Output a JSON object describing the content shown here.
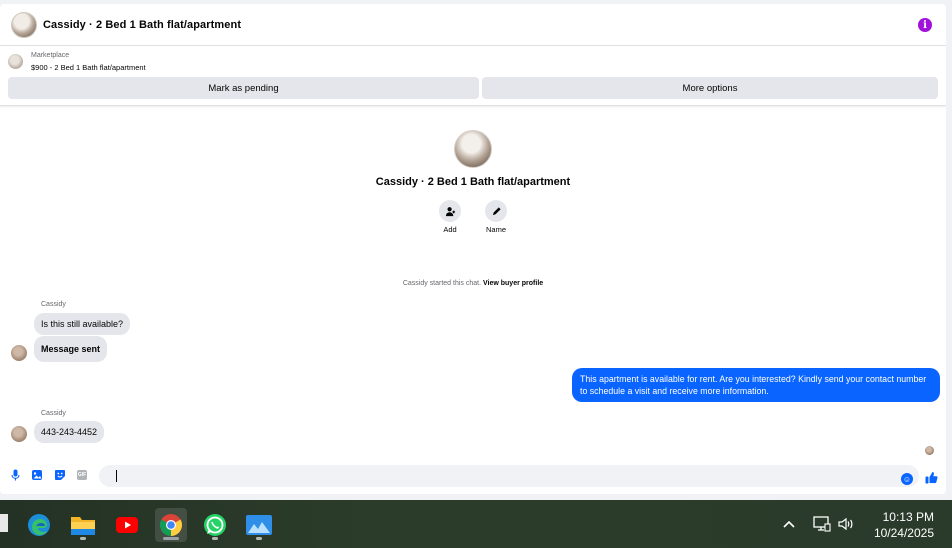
{
  "header": {
    "title": "Cassidy · 2 Bed 1 Bath flat/apartment",
    "info_icon": "i"
  },
  "listing": {
    "source": "Marketplace",
    "price_title": "$900 - 2 Bed 1 Bath flat/apartment",
    "mark_pending_label": "Mark as pending",
    "more_options_label": "More options"
  },
  "profile": {
    "name": "Cassidy · 2 Bed 1 Bath flat/apartment",
    "actions": [
      {
        "label": "Add",
        "icon": "add-person-icon"
      },
      {
        "label": "Name",
        "icon": "pencil-icon"
      }
    ]
  },
  "conversation": {
    "started_text": "Cassidy started this chat.",
    "view_profile_link": "View buyer profile",
    "messages": [
      {
        "sender": "Cassidy",
        "text": "Is this still available?"
      },
      {
        "sender": "",
        "text": "Message sent"
      },
      {
        "sender": "You",
        "text": "This apartment is available for rent. Are you interested? Kindly send your contact number to schedule a visit and receive more information."
      },
      {
        "sender": "Cassidy",
        "text": "443-243-4452"
      }
    ]
  },
  "composer": {
    "placeholder": "",
    "icons": [
      "microphone-icon",
      "photo-icon",
      "sticker-icon",
      "gif-icon",
      "emoji-icon",
      "like-icon"
    ],
    "gif_label": "GIF"
  },
  "taskbar": {
    "apps": [
      "edge",
      "file-explorer",
      "youtube",
      "chrome",
      "whatsapp",
      "photos"
    ],
    "active_app": "chrome",
    "time": "10:13 PM",
    "date": "10/24/2025"
  },
  "colors": {
    "accent": "#0a64ff",
    "info": "#a011d9",
    "bubble_in": "#e4e6eb",
    "taskbar": "#2b3b2b"
  }
}
